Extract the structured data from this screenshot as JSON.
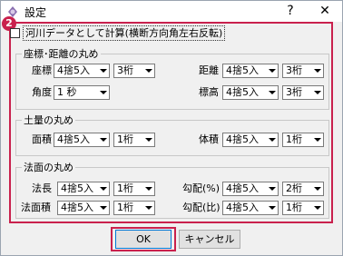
{
  "window": {
    "title": "設定",
    "help_glyph": "?",
    "close_glyph": "✕"
  },
  "badge": "2",
  "checkbox": {
    "label": "河川データとして計算(横断方向角左右反転)",
    "checked": false
  },
  "groups": {
    "distance": {
      "title": "座標･距離の丸め",
      "rows": [
        {
          "left_label": "座標",
          "left_method": "4捨5入",
          "left_digits": "3桁",
          "right_label": "距離",
          "right_method": "4捨5入",
          "right_digits": "3桁"
        },
        {
          "left_label": "角度",
          "left_method": "1 秒",
          "right_label": "標高",
          "right_method": "4捨5入",
          "right_digits": "3桁"
        }
      ]
    },
    "earth": {
      "title": "土量の丸め",
      "rows": [
        {
          "left_label": "面積",
          "left_method": "4捨5入",
          "left_digits": "1桁",
          "right_label": "体積",
          "right_method": "4捨5入",
          "right_digits": "1桁"
        }
      ]
    },
    "slope": {
      "title": "法面の丸め",
      "rows": [
        {
          "left_label": "法長",
          "left_method": "4捨5入",
          "left_digits": "1桁",
          "right_label": "勾配(%)",
          "right_method": "4捨5入",
          "right_digits": "2桁"
        },
        {
          "left_label": "法面積",
          "left_method": "4捨5入",
          "left_digits": "1桁",
          "right_label": "勾配(比)",
          "right_method": "4捨5入",
          "right_digits": "1桁"
        }
      ]
    }
  },
  "buttons": {
    "ok": "OK",
    "cancel": "キャンセル"
  },
  "colors": {
    "highlight": "#c9214d",
    "dialog_bg": "#f0f0f0"
  }
}
